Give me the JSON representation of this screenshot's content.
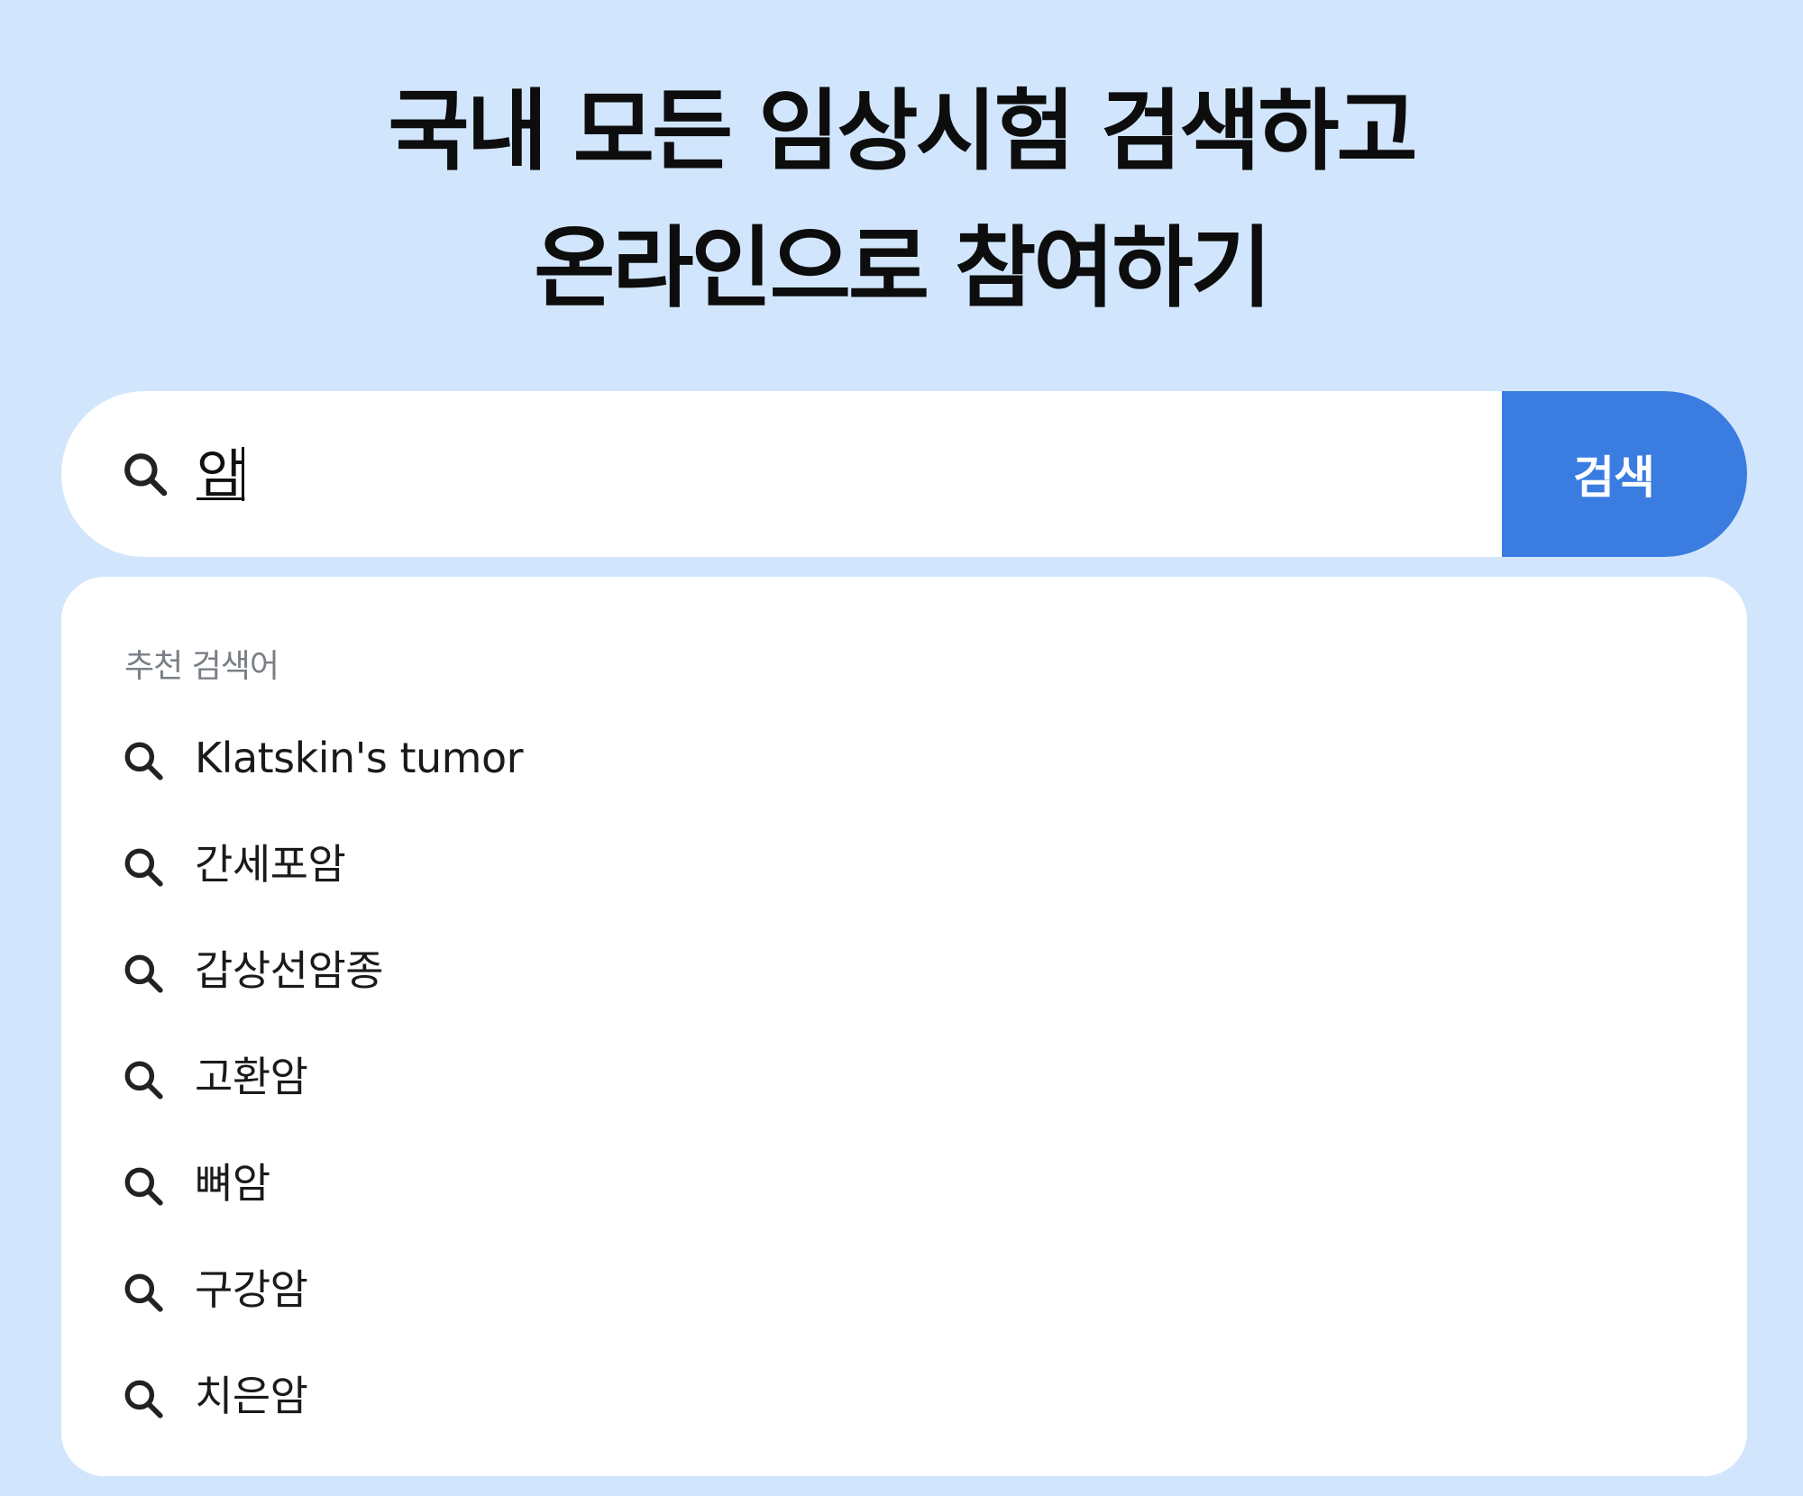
{
  "headline": {
    "line1": "국내 모든 임상시험 검색하고",
    "line2": "온라인으로 참여하기"
  },
  "search": {
    "icon": "search-icon",
    "value": "암",
    "button_label": "검색",
    "accent_color": "#3a7ce0"
  },
  "suggestions": {
    "heading": "추천 검색어",
    "items": [
      {
        "label": "Klatskin's tumor",
        "icon": "search-icon"
      },
      {
        "label": "간세포암",
        "icon": "search-icon"
      },
      {
        "label": "갑상선암종",
        "icon": "search-icon"
      },
      {
        "label": "고환암",
        "icon": "search-icon"
      },
      {
        "label": "뼈암",
        "icon": "search-icon"
      },
      {
        "label": "구강암",
        "icon": "search-icon"
      },
      {
        "label": "치은암",
        "icon": "search-icon"
      }
    ]
  },
  "colors": {
    "page_background": "#d1e6fd",
    "panel_background": "#ffffff",
    "heading_gray": "#7a7f86"
  }
}
